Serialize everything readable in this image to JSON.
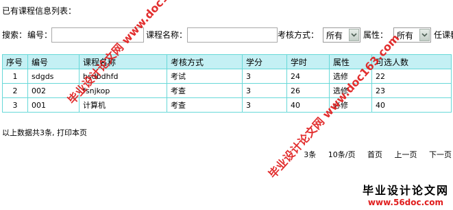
{
  "page_title": "已有课程信息列表：",
  "search": {
    "prefix": "搜索：",
    "code_label": "编号：",
    "code_value": "",
    "name_label": "课程名称：",
    "name_value": "",
    "exam_label": "考核方式：",
    "exam_value": "所有",
    "attr_label": "属性：",
    "attr_value": "所有",
    "trailing_label": "任课教"
  },
  "table": {
    "headers": [
      "序号",
      "编号",
      "课程名称",
      "考核方式",
      "学分",
      "学时",
      "属性",
      "可选人数"
    ],
    "rows": [
      [
        "1",
        "sdgds",
        "hsdbdhfd",
        "考试",
        "3",
        "24",
        "选修",
        "22"
      ],
      [
        "2",
        "002",
        "fsnjkop",
        "考查",
        "3",
        "26",
        "选修",
        "23"
      ],
      [
        "3",
        "001",
        "计算机",
        "考查",
        "3",
        "40",
        "必修",
        "40"
      ]
    ]
  },
  "summary": "以上数据共3条, 打印本页",
  "pager": {
    "total": "3条",
    "page_size": "10条/页",
    "first": "首页",
    "prev": "上一页",
    "next": "下一页"
  },
  "watermarks": {
    "mark1": "毕业设计论文网 www.doc163.com",
    "mark2": "毕业设计论文网 www.doc163.com",
    "logo_line1": "毕业设计论文网",
    "logo_line2": "www.56doc.com"
  },
  "colors": {
    "table_border": "#66d8d8",
    "header_bg": "#c4f0f4",
    "watermark": "#e01d1d"
  }
}
